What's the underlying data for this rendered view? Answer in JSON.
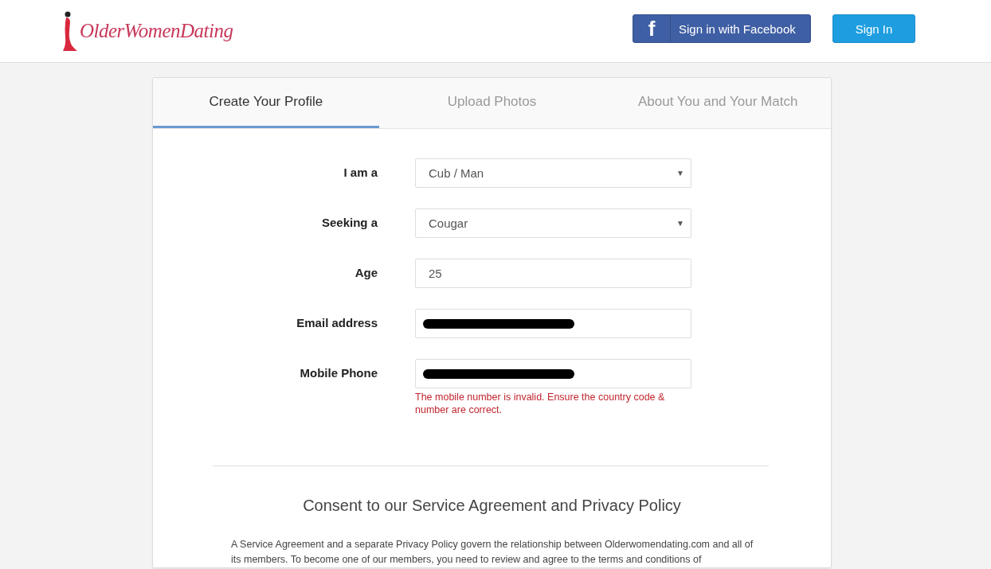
{
  "header": {
    "logo_text": "OlderWomenDating",
    "buttons": [
      {
        "kind": "facebook",
        "icon": "f",
        "label": "Sign in with Facebook"
      },
      {
        "kind": "primary",
        "label": "Sign In"
      }
    ]
  },
  "tabs": [
    {
      "label": "Create Your Profile",
      "selected": true
    },
    {
      "label": "Upload Photos",
      "selected": false
    },
    {
      "label": "About You and Your Match",
      "selected": false
    }
  ],
  "form": [
    {
      "label": "I am a",
      "kind": "select",
      "value": "Cub / Man",
      "caret": "▼"
    },
    {
      "label": "Seeking a",
      "kind": "select",
      "value": "Cougar",
      "caret": "▼"
    },
    {
      "label": "Age",
      "kind": "text",
      "value": "25"
    },
    {
      "label": "Email address",
      "kind": "text",
      "redacted": true
    },
    {
      "label": "Mobile Phone",
      "kind": "text",
      "redacted": true,
      "error": "The mobile number is invalid. Ensure the country code & number are correct."
    }
  ],
  "consent": {
    "heading": "Consent to our Service Agreement and Privacy Policy",
    "text": "A Service Agreement and a separate Privacy Policy govern the relationship between Olderwomendating.com and all of its members. To become one of our members, you need to review and agree to the terms and conditions of"
  }
}
